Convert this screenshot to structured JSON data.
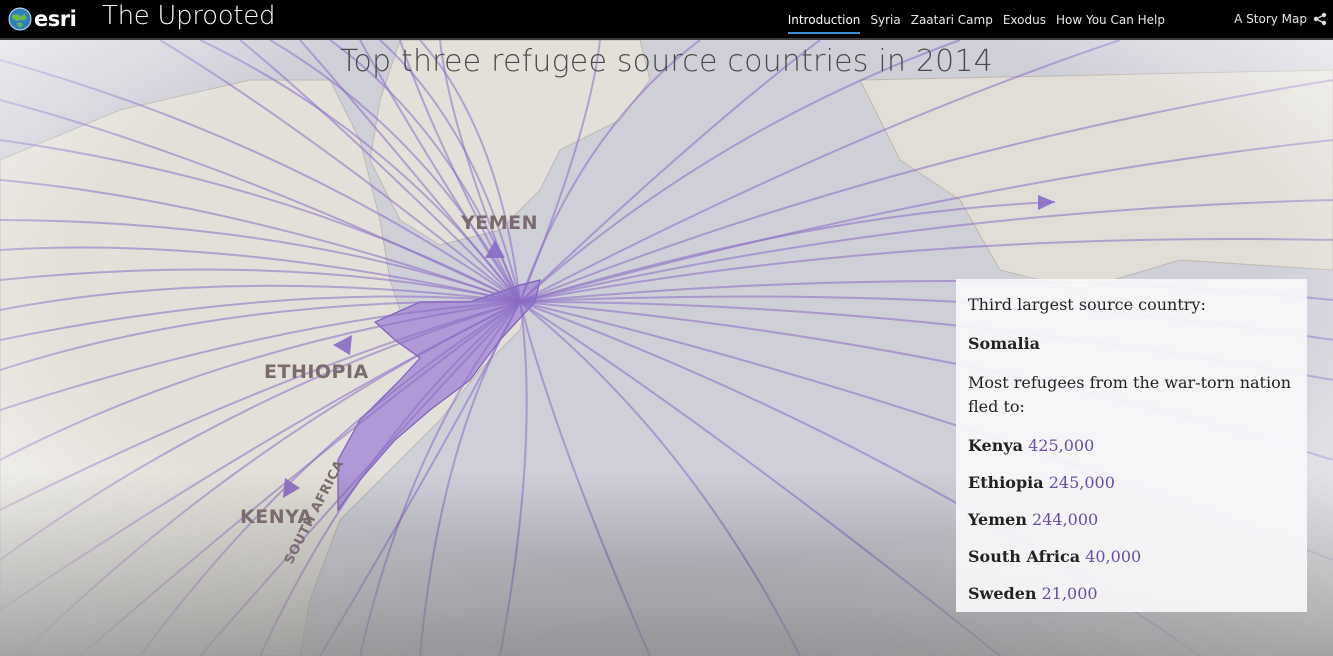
{
  "app": {
    "logo_text": "esri",
    "title": "The Uprooted"
  },
  "nav": {
    "tabs": [
      {
        "label": "Introduction",
        "active": true
      },
      {
        "label": "Syria",
        "active": false
      },
      {
        "label": "Zaatari Camp",
        "active": false
      },
      {
        "label": "Exodus",
        "active": false
      },
      {
        "label": "How You Can Help",
        "active": false
      }
    ],
    "story_map_label": "A Story Map",
    "share_icon": "share-icon"
  },
  "map": {
    "heading": "Top three refugee source countries in 2014",
    "labels": {
      "yemen": "YEMEN",
      "ethiopia": "ETHIOPIA",
      "kenya": "KENYA",
      "south_africa": "SOUTH AFRICA"
    },
    "colors": {
      "flow_line": "#8a6cc4",
      "source_country_fill": "#9d7fd0",
      "ocean": "#cfcfd9",
      "land": "#e6e3dc"
    }
  },
  "panel": {
    "intro": "Third largest source country:",
    "country": "Somalia",
    "description": "Most refugees from the war-torn nation fled to:",
    "destinations": [
      {
        "name": "Kenya",
        "value": "425,000"
      },
      {
        "name": "Ethiopia",
        "value": "245,000"
      },
      {
        "name": "Yemen",
        "value": "244,000"
      },
      {
        "name": "South Africa",
        "value": "40,000"
      },
      {
        "name": "Sweden",
        "value": "21,000"
      }
    ]
  }
}
